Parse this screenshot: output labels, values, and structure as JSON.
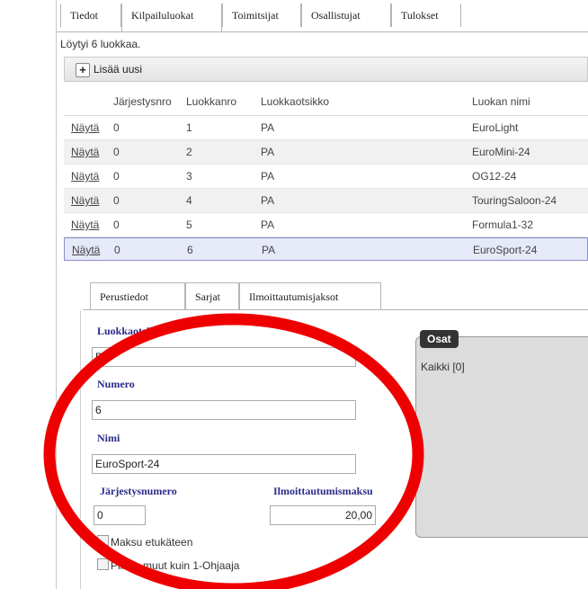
{
  "top_tabs": [
    "Tiedot",
    "Kilpailuluokat",
    "Toimitsijat",
    "Osallistujat",
    "Tulokset"
  ],
  "results_text": "Löytyi 6 luokkaa.",
  "toolbar": {
    "add_label": "Lisää uusi",
    "add_icon": "+"
  },
  "table": {
    "headers": [
      "Järjestysnro",
      "Luokkanro",
      "Luokkaotsikko",
      "Luokan nimi"
    ],
    "link_label": "Näytä",
    "rows": [
      {
        "order": "0",
        "num": "1",
        "title": "PA",
        "name": "EuroLight"
      },
      {
        "order": "0",
        "num": "2",
        "title": "PA",
        "name": "EuroMini-24"
      },
      {
        "order": "0",
        "num": "3",
        "title": "PA",
        "name": "OG12-24"
      },
      {
        "order": "0",
        "num": "4",
        "title": "PA",
        "name": "TouringSaloon-24"
      },
      {
        "order": "0",
        "num": "5",
        "title": "PA",
        "name": "Formula1-32"
      },
      {
        "order": "0",
        "num": "6",
        "title": "PA",
        "name": "EuroSport-24"
      }
    ]
  },
  "detail_tabs": [
    "Perustiedot",
    "Sarjat",
    "Ilmoittautumisjaksot"
  ],
  "form": {
    "title_label": "Luokkaotsikko",
    "title_value": "PA",
    "number_label": "Numero",
    "number_value": "6",
    "name_label": "Nimi",
    "name_value": "EuroSport-24",
    "order_label": "Järjestysnumero",
    "order_value": "0",
    "fee_label": "Ilmoittautumismaksu",
    "fee_value": "20,00",
    "prepay_label": "Maksu etukäteen",
    "hide_label": "Piilota muut kuin 1-Ohjaaja"
  },
  "osat": {
    "title": "Osat",
    "item": "Kaikki [0]"
  },
  "colors": {
    "selected_row": "#e6e9f8",
    "label": "#2a2a8a",
    "annotation": "#ee0000"
  }
}
